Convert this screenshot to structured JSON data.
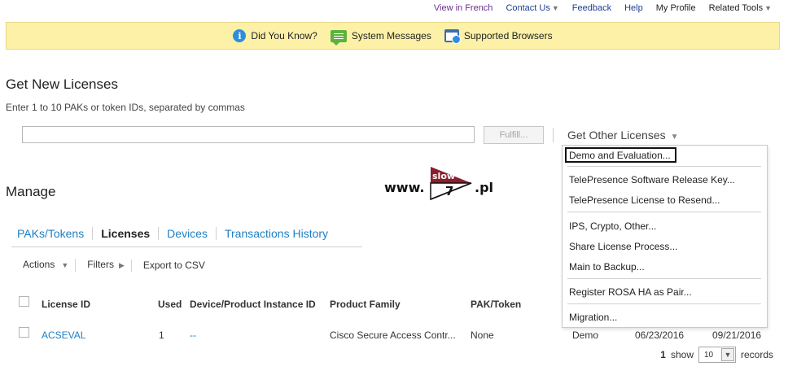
{
  "top_links": [
    {
      "label": "View in French",
      "style": "purple"
    },
    {
      "label": "Contact Us",
      "style": "blue",
      "has_caret": true
    },
    {
      "label": "Feedback",
      "style": "blue"
    },
    {
      "label": "Help",
      "style": "blue"
    },
    {
      "label": "My Profile",
      "style": "black"
    },
    {
      "label": "Related Tools",
      "style": "black",
      "has_caret": true
    }
  ],
  "banner": {
    "did_you_know": "Did You Know?",
    "system_messages": "System Messages",
    "supported_browsers": "Supported Browsers",
    "background": "#fcf1a7"
  },
  "get_licenses": {
    "title": "Get New Licenses",
    "hint": "Enter 1 to 10 PAKs or token IDs, separated by commas",
    "input_value": "",
    "fulfill_label": "Fulfill...",
    "get_other_label": "Get Other Licenses"
  },
  "dropdown": {
    "items": [
      "Demo and Evaluation...",
      "TelePresence Software Release Key...",
      "TelePresence License to Resend...",
      "IPS, Crypto, Other...",
      "Share License Process...",
      "Main to Backup...",
      "Register ROSA HA as Pair...",
      "Migration..."
    ]
  },
  "watermark": {
    "prefix": "www.",
    "badge_top": "slow",
    "badge_bottom": "7",
    "suffix": ".pl"
  },
  "manage": {
    "title": "Manage",
    "tabs": [
      "PAKs/Tokens",
      "Licenses",
      "Devices",
      "Transactions History"
    ],
    "active_tab": "Licenses",
    "toolbar": {
      "actions": "Actions",
      "filters": "Filters",
      "export": "Export to CSV"
    }
  },
  "table": {
    "headers": {
      "license_id": "License ID",
      "used": "Used",
      "device": "Device/Product Instance ID",
      "product_family": "Product Family",
      "pak_token": "PAK/Token"
    },
    "rows": [
      {
        "license_id": "ACSEVAL",
        "used": "1",
        "device": "--",
        "product_family": "Cisco Secure Access Contr...",
        "pak_token": "None",
        "type": "Demo",
        "start_date": "06/23/2016",
        "end_date": "09/21/2016"
      }
    ]
  },
  "pager": {
    "count": "1",
    "show_label": "show",
    "page_size": "10",
    "records_label": "records"
  },
  "colors": {
    "link_blue": "#1e7fc4",
    "banner_yellow": "#fcf1a7",
    "badge_red": "#8b1e2d"
  }
}
